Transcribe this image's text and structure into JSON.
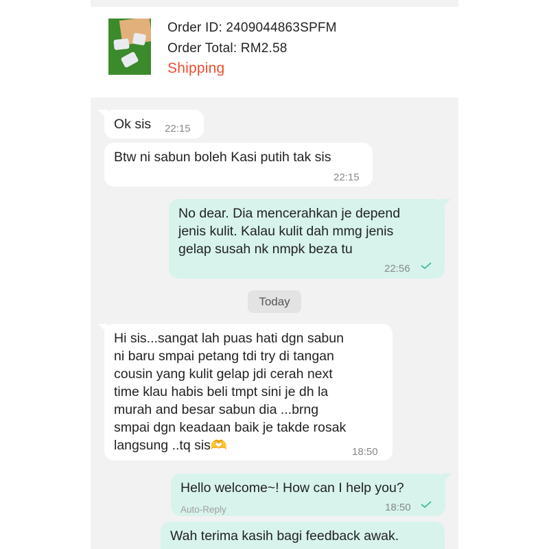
{
  "order": {
    "id_text": "Order ID: 2409044863SPFM",
    "total_text": "Order Total: RM2.58",
    "status": "Shipping"
  },
  "messages": [
    {
      "direction": "in",
      "text": "Ok sis",
      "time": "22:15"
    },
    {
      "direction": "in",
      "text": "Btw ni sabun boleh Kasi putih tak sis",
      "time": "22:15"
    },
    {
      "direction": "out",
      "text": "No dear. Dia mencerahkan je depend\njenis kulit. Kalau kulit dah mmg jenis\ngelap susah nk nmpk beza tu",
      "time": "22:56",
      "read": true
    },
    {
      "direction": "in",
      "text": "Hi sis...sangat lah puas hati dgn sabun\nni baru smpai petang tdi try di tangan\ncousin yang kulit gelap jdi cerah next\ntime klau habis beli tmpt sini je dh la\nmurah and besar sabun dia ...brng\nsmpai dgn keadaan baik je takde rosak\nlangsung ..tq  sis🫶",
      "time": "18:50"
    },
    {
      "direction": "out",
      "text": "Hello welcome~! How can I help you?",
      "label": "Auto-Reply",
      "time": "18:50",
      "read": true
    },
    {
      "direction": "out",
      "text": "Wah terima kasih bagi feedback awak."
    }
  ],
  "date_divider": "Today",
  "colors": {
    "accent": "#ee4d2d",
    "outgoing_bubble": "#d7f3ec",
    "incoming_bubble": "#ffffff",
    "chat_bg": "#f2f2f2",
    "check": "#3fb89a"
  }
}
